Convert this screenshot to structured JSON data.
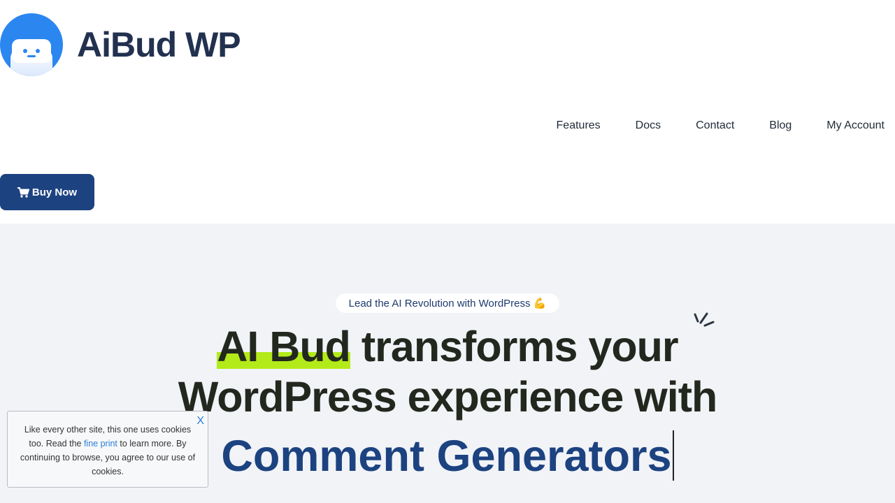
{
  "brand": {
    "name": "AiBud WP"
  },
  "nav": {
    "items": [
      "Features",
      "Docs",
      "Contact",
      "Blog",
      "My Account"
    ]
  },
  "buy_button": {
    "label": "Buy Now"
  },
  "hero": {
    "tagline": "Lead the AI Revolution with WordPress 💪",
    "headline_highlight": "AI Bud",
    "headline_rest": " transforms your",
    "headline_line2": "WordPress experience with",
    "typed_text": "Comment Generators"
  },
  "cookie": {
    "text_before": "Like every other site, this one uses cookies too. Read the ",
    "link": "fine print",
    "text_after": " to learn more. By continuing to browse, you agree to our use of cookies.",
    "close": "X"
  },
  "colors": {
    "accent": "#1c4280",
    "logo_blue": "#2b86f0",
    "highlight": "#b3ea19",
    "hero_bg": "#f1f3f7"
  }
}
